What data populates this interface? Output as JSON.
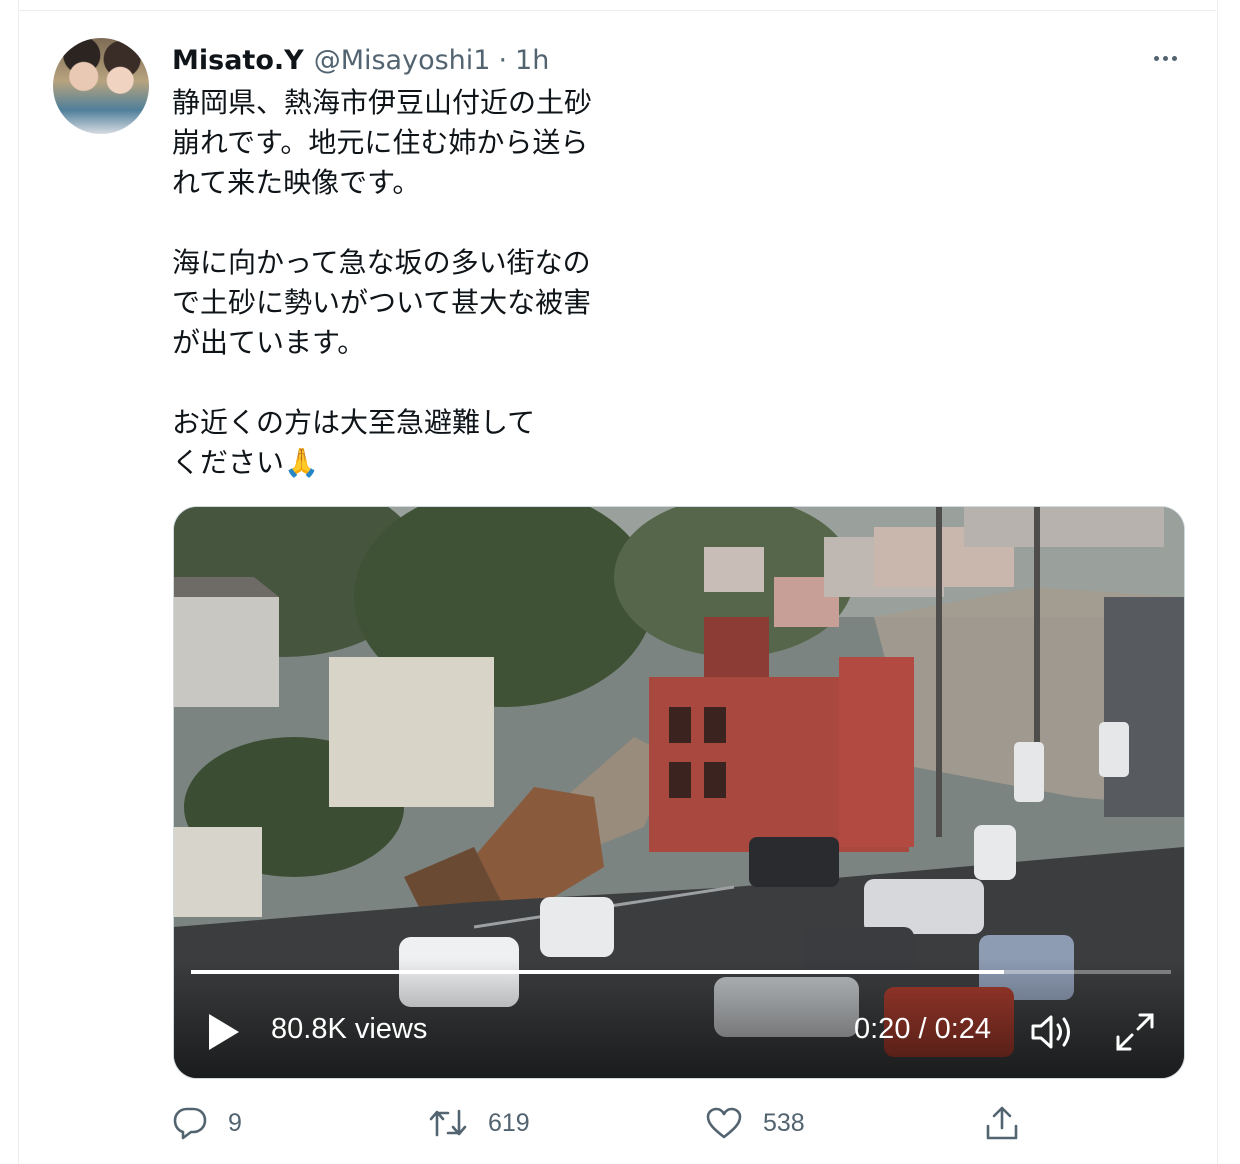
{
  "tweet": {
    "display_name": "Misato.Y",
    "handle": "@Misayoshi1",
    "separator": "·",
    "time": "1h",
    "text": "静岡県、熱海市伊豆山付近の土砂\n崩れです。地元に住む姉から送ら\nれて来た映像です。\n\n海に向かって急な坂の多い街なの\nで土砂に勢いがついて甚大な被害\nが出ています。\n\nお近くの方は大至急避難して\nください🙏"
  },
  "video": {
    "views": "80.8K views",
    "time_display": "0:20 / 0:24",
    "progress": 0.83
  },
  "actions": {
    "replies": "9",
    "retweets": "619",
    "likes": "538"
  },
  "icons": {
    "reply": "reply-icon",
    "retweet": "retweet-icon",
    "like": "heart-icon",
    "share": "share-icon",
    "more": "more-icon",
    "play": "play-icon",
    "volume": "volume-icon",
    "fullscreen": "fullscreen-icon"
  },
  "colors": {
    "text": "#0f1419",
    "secondary": "#536471",
    "border": "#cfd9de"
  }
}
